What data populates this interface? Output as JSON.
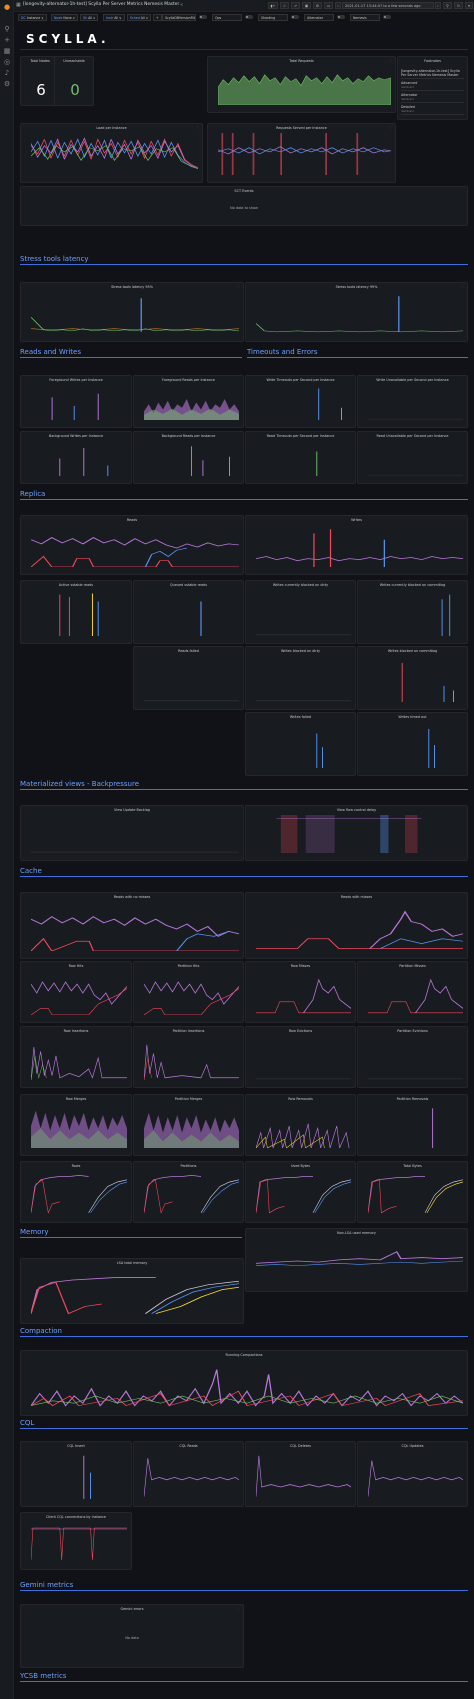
{
  "title": "[longevity-alternator-1h-test] Scylla Per Server Metrics Nemesis Master",
  "time_range": "2021-01-17 13:44:07 to a few seconds ago",
  "logo": "SCYLLA.",
  "variables": [
    {
      "key": "DC",
      "value": "Instance ∨"
    },
    {
      "key": "Node",
      "value": "None ∨"
    },
    {
      "key": "Sh",
      "value": "All ∨"
    },
    {
      "key": "Instr",
      "value": "All ∨"
    },
    {
      "key": "Sched",
      "value": "All ∨"
    }
  ],
  "toggles": [
    "ScyllaDBVersionFilter",
    "Ops",
    "Sharding",
    "Alternator",
    "Nemesis"
  ],
  "stats": {
    "total_nodes_label": "Total Nodes",
    "total_nodes": "6",
    "unreachable_label": "Unreachable",
    "unreachable": "0"
  },
  "panels": {
    "total_requests": "Total Requests",
    "footnotes": "Footnotes",
    "load": "Load per Instance",
    "requests_served": "Requests Served per Instance",
    "sct_events": "SCT Events",
    "stress_p95": "Stress tools latency 95%",
    "stress_p99": "Stress tools latency 99%",
    "fg_writes": "Foreground Writes per Instance",
    "fg_reads": "Foreground Reads per Instance",
    "write_timeouts": "Write Timeouts per Second per Instance",
    "write_unavailable": "Write Unavailable per Second per Instance",
    "bg_writes": "Background Writes per Instance",
    "bg_reads": "Background Reads per Instance",
    "read_timeouts": "Read Timeouts per Second per Instance",
    "read_unavailable": "Read Unavailable per Second per Instance",
    "reads": "Reads",
    "writes": "Writes",
    "active_sstable_reads": "Active sstable reads",
    "queued_sstable_reads": "Queued sstable reads",
    "writes_blocked_dirty": "Writes currently blocked on dirty",
    "writes_blocked_commitlog": "Writes currently blocked on commitlog",
    "reads_failed": "Reads failed",
    "writes_blocked_dirty2": "Writes blocked on dirty",
    "writes_blocked_commitlog2": "Writes blocked on commitlog",
    "writes_failed": "Writes failed",
    "writes_timed_out": "Writes timed out",
    "view_update_backlog": "View Update Backlog",
    "view_flow_delay": "View flow control delay",
    "reads_no_misses": "Reads with no misses",
    "reads_misses": "Reads with misses",
    "row_hits": "Row Hits",
    "partition_hits": "Partition Hits",
    "row_misses": "Row Misses",
    "partition_misses": "Partition Misses",
    "row_insertions": "Row Insertions",
    "partition_insertions": "Partition Insertions",
    "row_evictions": "Row Evictions",
    "partition_evictions": "Partition Evictions",
    "row_merges": "Row Merges",
    "partition_merges": "Partition Merges",
    "row_removals": "Row Removals",
    "partition_removals": "Partition Removals",
    "rows": "Rows",
    "partitions": "Partitions",
    "used_bytes": "Used Bytes",
    "total_bytes": "Total Bytes",
    "non_lsa": "Non-LSA used memory",
    "lsa_total": "LSA total memory",
    "running_compactions": "Running Compactions",
    "cql_insert": "CQL Insert",
    "cql_reads": "CQL Reads",
    "cql_deletes": "CQL Deletes",
    "cql_updates": "CQL Updates",
    "client_cql": "Client CQL connections by instance",
    "gemini_errors": "Gemini errors"
  },
  "footnotes": [
    {
      "label": "[longevity-alternator-1h-test] Scylla Per Server Metrics Nemesis Master",
      "sub": ""
    },
    {
      "label": "Advanced",
      "sub": "dashboard"
    },
    {
      "label": "Alternator",
      "sub": "dashboard"
    },
    {
      "label": "Detailed",
      "sub": "dashboard"
    }
  ],
  "sections": {
    "stress": "Stress tools latency",
    "rw": "Reads and Writes",
    "timeouts": "Timeouts and Errors",
    "replica": "Replica",
    "mv": "Materialized views - Backpressure",
    "cache": "Cache",
    "memory": "Memory",
    "compaction": "Compaction",
    "cql": "CQL",
    "gemini": "Gemini metrics",
    "ycsb": "YCSB metrics"
  },
  "no_data": "No data",
  "no_data_to_show": "No data to show",
  "x_ticks": [
    "13:45",
    "14:00",
    "14:15",
    "14:30",
    "14:45"
  ],
  "colors": {
    "accent": "#6e9fff",
    "green": "#73bf69",
    "red": "#f2495c",
    "blue": "#5794f2",
    "purple": "#b877d9",
    "yellow": "#fade2a",
    "orange": "#ff9830"
  }
}
